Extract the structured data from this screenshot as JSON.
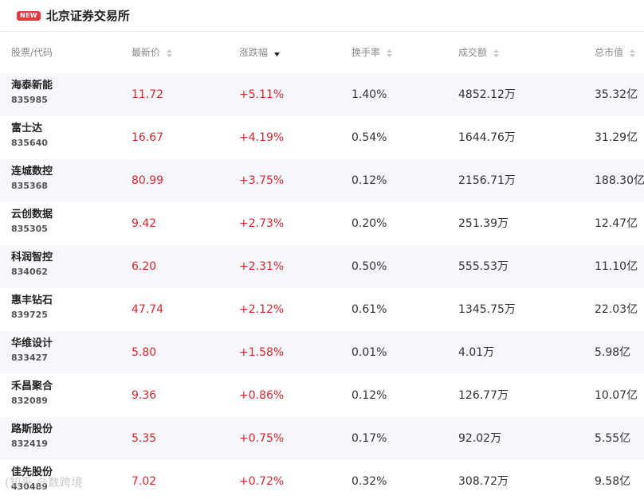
{
  "header": {
    "badge": "NEW",
    "title": "北京证券交易所"
  },
  "columns": {
    "name": "股票/代码",
    "price": "最新价",
    "change": "涨跌幅",
    "turnover": "换手率",
    "volume": "成交额",
    "market_cap": "总市值"
  },
  "sort": {
    "active_column": "涨跌幅",
    "direction": "desc"
  },
  "rows": [
    {
      "name": "海泰新能",
      "code": "835985",
      "price": "11.72",
      "change": "+5.11%",
      "turnover": "1.40%",
      "volume": "4852.12万",
      "market_cap": "35.32亿"
    },
    {
      "name": "富士达",
      "code": "835640",
      "price": "16.67",
      "change": "+4.19%",
      "turnover": "0.54%",
      "volume": "1644.76万",
      "market_cap": "31.29亿"
    },
    {
      "name": "连城数控",
      "code": "835368",
      "price": "80.99",
      "change": "+3.75%",
      "turnover": "0.12%",
      "volume": "2156.71万",
      "market_cap": "188.30亿"
    },
    {
      "name": "云创数据",
      "code": "835305",
      "price": "9.42",
      "change": "+2.73%",
      "turnover": "0.20%",
      "volume": "251.39万",
      "market_cap": "12.47亿"
    },
    {
      "name": "科润智控",
      "code": "834062",
      "price": "6.20",
      "change": "+2.31%",
      "turnover": "0.50%",
      "volume": "555.53万",
      "market_cap": "11.10亿"
    },
    {
      "name": "惠丰钻石",
      "code": "839725",
      "price": "47.74",
      "change": "+2.12%",
      "turnover": "0.61%",
      "volume": "1345.75万",
      "market_cap": "22.03亿"
    },
    {
      "name": "华维设计",
      "code": "833427",
      "price": "5.80",
      "change": "+1.58%",
      "turnover": "0.01%",
      "volume": "4.01万",
      "market_cap": "5.98亿"
    },
    {
      "name": "禾昌聚合",
      "code": "832089",
      "price": "9.36",
      "change": "+0.86%",
      "turnover": "0.12%",
      "volume": "126.77万",
      "market_cap": "10.07亿"
    },
    {
      "name": "路斯股份",
      "code": "832419",
      "price": "5.35",
      "change": "+0.75%",
      "turnover": "0.17%",
      "volume": "92.02万",
      "market_cap": "5.55亿"
    },
    {
      "name": "佳先股份",
      "code": "430489",
      "price": "7.02",
      "change": "+0.72%",
      "turnover": "0.32%",
      "volume": "308.72万",
      "market_cap": "9.58亿"
    }
  ],
  "watermark": "(知乎 @数跨境",
  "colors": {
    "up": "#d6272f",
    "badge": "#e8383d",
    "alt_row": "#f6f7fa",
    "header_text": "#8a8a8a"
  }
}
